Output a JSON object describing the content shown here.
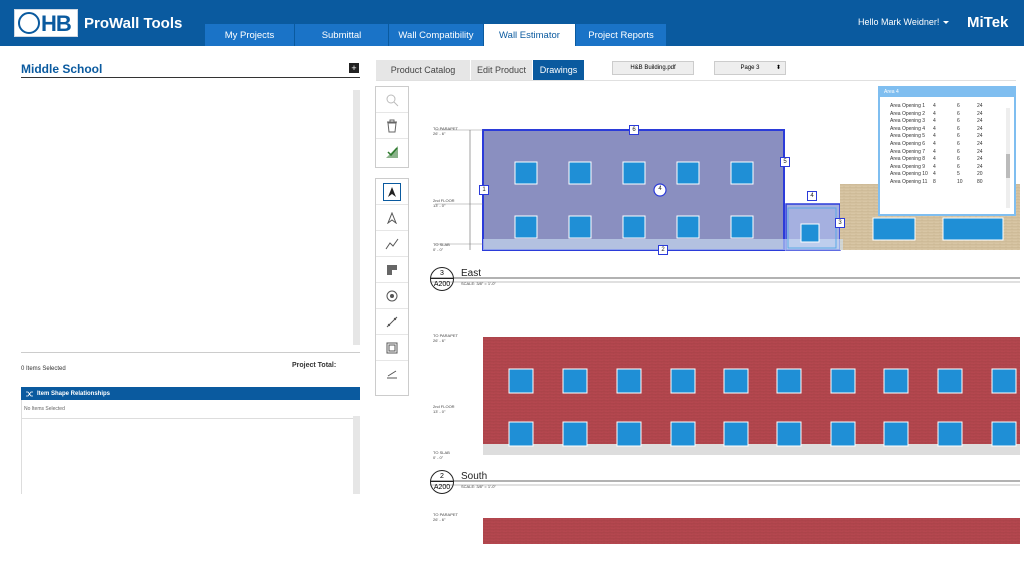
{
  "app": {
    "brand": "ProWall Tools",
    "logo_text": "HB",
    "company": "MiTek",
    "greeting": "Hello Mark Weidner!"
  },
  "nav": {
    "tabs": [
      {
        "label": "My Projects"
      },
      {
        "label": "Submittal"
      },
      {
        "label": "Wall Compatibility"
      },
      {
        "label": "Wall Estimator",
        "active": true
      },
      {
        "label": "Project Reports"
      }
    ]
  },
  "left_panel": {
    "project_title": "Middle School",
    "items_selected": "0 Items Selected",
    "project_total_label": "Project Total:",
    "relationships_title": "Item Shape Relationships",
    "relationships_empty": "No Items Selected"
  },
  "subtabs": [
    {
      "label": "Product Catalog"
    },
    {
      "label": "Edit Product"
    },
    {
      "label": "Drawings",
      "active": true
    }
  ],
  "file_button": "H&B Building.pdf",
  "page_select": "Page 3",
  "drawing": {
    "elevations": [
      {
        "number": "3",
        "sheet": "A200",
        "name": "East",
        "scale": "SCALE: 3/8\" = 1'-0\""
      },
      {
        "number": "2",
        "sheet": "A200",
        "name": "South",
        "scale": "SCALE: 3/8\" = 1'-0\""
      }
    ],
    "levels": {
      "parapet": "TO PARAPET",
      "parapet_val": "26' - 6\"",
      "floor2": "2nd FLOOR",
      "floor2_val": "13' - 0\"",
      "slab": "TO SLAB",
      "slab_val": "0' - 0\""
    },
    "edge_tags": [
      "1",
      "2",
      "3",
      "4",
      "5",
      "6"
    ],
    "area_tag": "4"
  },
  "popup": {
    "title": "Area 4",
    "rows": [
      [
        "Area Opening 1",
        "4",
        "6",
        "24"
      ],
      [
        "Area Opening 2",
        "4",
        "6",
        "24"
      ],
      [
        "Area Opening 3",
        "4",
        "6",
        "24"
      ],
      [
        "Area Opening 4",
        "4",
        "6",
        "24"
      ],
      [
        "Area Opening 5",
        "4",
        "6",
        "24"
      ],
      [
        "Area Opening 6",
        "4",
        "6",
        "24"
      ],
      [
        "Area Opening 7",
        "4",
        "6",
        "24"
      ],
      [
        "Area Opening 8",
        "4",
        "6",
        "24"
      ],
      [
        "Area Opening 9",
        "4",
        "6",
        "24"
      ],
      [
        "Area Opening 10",
        "4",
        "5",
        "20"
      ],
      [
        "Area Opening 11",
        "8",
        "10",
        "80"
      ]
    ]
  },
  "colors": {
    "primary": "#0a5a9f",
    "tab": "#1a73c7",
    "brick": "#b5474f",
    "window": "#1f8fd6",
    "selection": "#2b3bd9",
    "selected_fill": "#8a8fc0"
  },
  "icons": [
    "zoom-icon",
    "trash-icon",
    "check-icon",
    "pointer-icon",
    "text-tool-icon",
    "line-tool-icon",
    "shape-tool-icon",
    "target-icon",
    "measure-icon",
    "frame-icon",
    "calibrate-icon",
    "plus-icon",
    "relationship-icon"
  ]
}
